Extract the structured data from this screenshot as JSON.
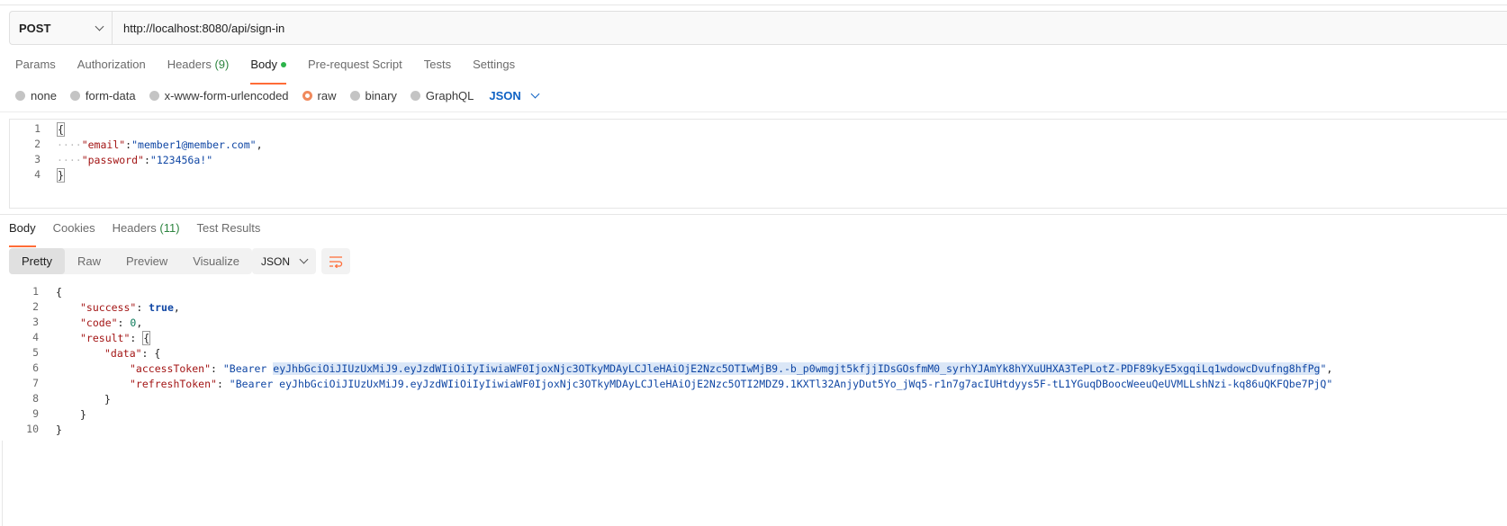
{
  "request": {
    "method": "POST",
    "url": "http://localhost:8080/api/sign-in"
  },
  "request_tabs": [
    {
      "label": "Params",
      "count": ""
    },
    {
      "label": "Authorization",
      "count": ""
    },
    {
      "label": "Headers",
      "count": "(9)"
    },
    {
      "label": "Body",
      "count": ""
    },
    {
      "label": "Pre-request Script",
      "count": ""
    },
    {
      "label": "Tests",
      "count": ""
    },
    {
      "label": "Settings",
      "count": ""
    }
  ],
  "body_types": [
    "none",
    "form-data",
    "x-www-form-urlencoded",
    "raw",
    "binary",
    "GraphQL"
  ],
  "body_format": "JSON",
  "request_body": {
    "line_numbers": [
      "1",
      "2",
      "3",
      "4"
    ],
    "open": "{",
    "close": "}",
    "email_key": "\"email\"",
    "email_value": "\"member1@member.com\"",
    "password_key": "\"password\"",
    "password_value": "\"123456a!\""
  },
  "response_tabs": [
    {
      "label": "Body",
      "count": ""
    },
    {
      "label": "Cookies",
      "count": ""
    },
    {
      "label": "Headers",
      "count": "(11)"
    },
    {
      "label": "Test Results",
      "count": ""
    }
  ],
  "view_modes": [
    "Pretty",
    "Raw",
    "Preview",
    "Visualize"
  ],
  "response_format": "JSON",
  "response_body": {
    "line_numbers": [
      "1",
      "2",
      "3",
      "4",
      "5",
      "6",
      "7",
      "8",
      "9",
      "10"
    ],
    "open": "{",
    "close": "}",
    "success_key": "\"success\"",
    "success_value": "true",
    "code_key": "\"code\"",
    "code_value": "0",
    "result_key": "\"result\"",
    "data_key": "\"data\"",
    "access_key": "\"accessToken\"",
    "access_prefix": "\"Bearer ",
    "access_selected": "eyJhbGciOiJIUzUxMiJ9.eyJzdWIiOiIyIiwiaWF0IjoxNjc3OTkyMDAyLCJleHAiOjE2Nzc5OTIwMjB9.-b_p0wmgjt5kfjjIDsGOsfmM0_syrhYJAmYk8hYXuUHXA3TePLotZ-PDF89kyE5xgqiLq1wdowcDvufng8hfPg",
    "access_suffix": "\"",
    "refresh_key": "\"refreshToken\"",
    "refresh_value": "\"Bearer eyJhbGciOiJIUzUxMiJ9.eyJzdWIiOiIyIiwiaWF0IjoxNjc3OTkyMDAyLCJleHAiOjE2Nzc5OTI2MDZ9.1KXTl32AnjyDut5Yo_jWq5-r1n7g7acIUHtdyys5F-tL1YGuqDBoocWeeuQeUVMLLshNzi-kq86uQKFQbe7PjQ\""
  },
  "colors": {
    "accent": "#ff6c37",
    "json_key": "#a31515",
    "json_string": "#0f46a4",
    "json_number": "#0b7a5a",
    "active_dot": "#2cb34a"
  }
}
